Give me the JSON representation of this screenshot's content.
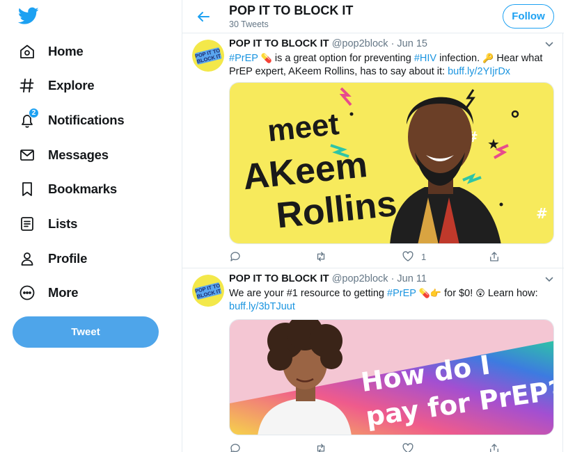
{
  "sidebar": {
    "logo_icon": "twitter-bird-icon",
    "items": [
      {
        "label": "Home",
        "icon": "home-icon"
      },
      {
        "label": "Explore",
        "icon": "hashtag-icon"
      },
      {
        "label": "Notifications",
        "icon": "bell-icon",
        "badge": "2"
      },
      {
        "label": "Messages",
        "icon": "envelope-icon"
      },
      {
        "label": "Bookmarks",
        "icon": "bookmark-icon"
      },
      {
        "label": "Lists",
        "icon": "list-icon"
      },
      {
        "label": "Profile",
        "icon": "person-icon"
      },
      {
        "label": "More",
        "icon": "more-circle-icon"
      }
    ],
    "tweet_button": "Tweet"
  },
  "header": {
    "title": "POP IT TO BLOCK IT",
    "subtitle": "30 Tweets",
    "follow_label": "Follow"
  },
  "tweets": [
    {
      "name": "POP IT TO BLOCK IT",
      "handle": "@pop2block",
      "date": "· Jun 15",
      "text": {
        "hashtag1": "#PrEP",
        "part1": " is a great option for preventing ",
        "hashtag2": "#HIV",
        "part2": " infection. ",
        "part3": " Hear what PrEP expert, AKeem Rollins, has to say about it: ",
        "link": "buff.ly/2YIjrDx"
      },
      "media_title_line1": "meet",
      "media_title_line2": "AKeem",
      "media_title_line3": "Rollins",
      "replies": "",
      "retweets": "",
      "likes": "1"
    },
    {
      "name": "POP IT TO BLOCK IT",
      "handle": "@pop2block",
      "date": "· Jun 11",
      "text": {
        "part1": "We are your #1 resource to getting ",
        "hashtag1": "#PrEP",
        "part2": " for $0! ",
        "part3": " Learn how: ",
        "link": "buff.ly/3bTJuut"
      },
      "media_title_line1": "How do I",
      "media_title_line2": "pay for PrEP?",
      "replies": "",
      "retweets": "",
      "likes": ""
    }
  ],
  "avatar_text_line1": "POP IT TO",
  "avatar_text_line2": "BLOCK IT",
  "colors": {
    "brand": "#1da1f2",
    "link": "#1b95e0",
    "tweet_button": "#4ea5ea",
    "media1_bg": "#f7ea5c"
  }
}
